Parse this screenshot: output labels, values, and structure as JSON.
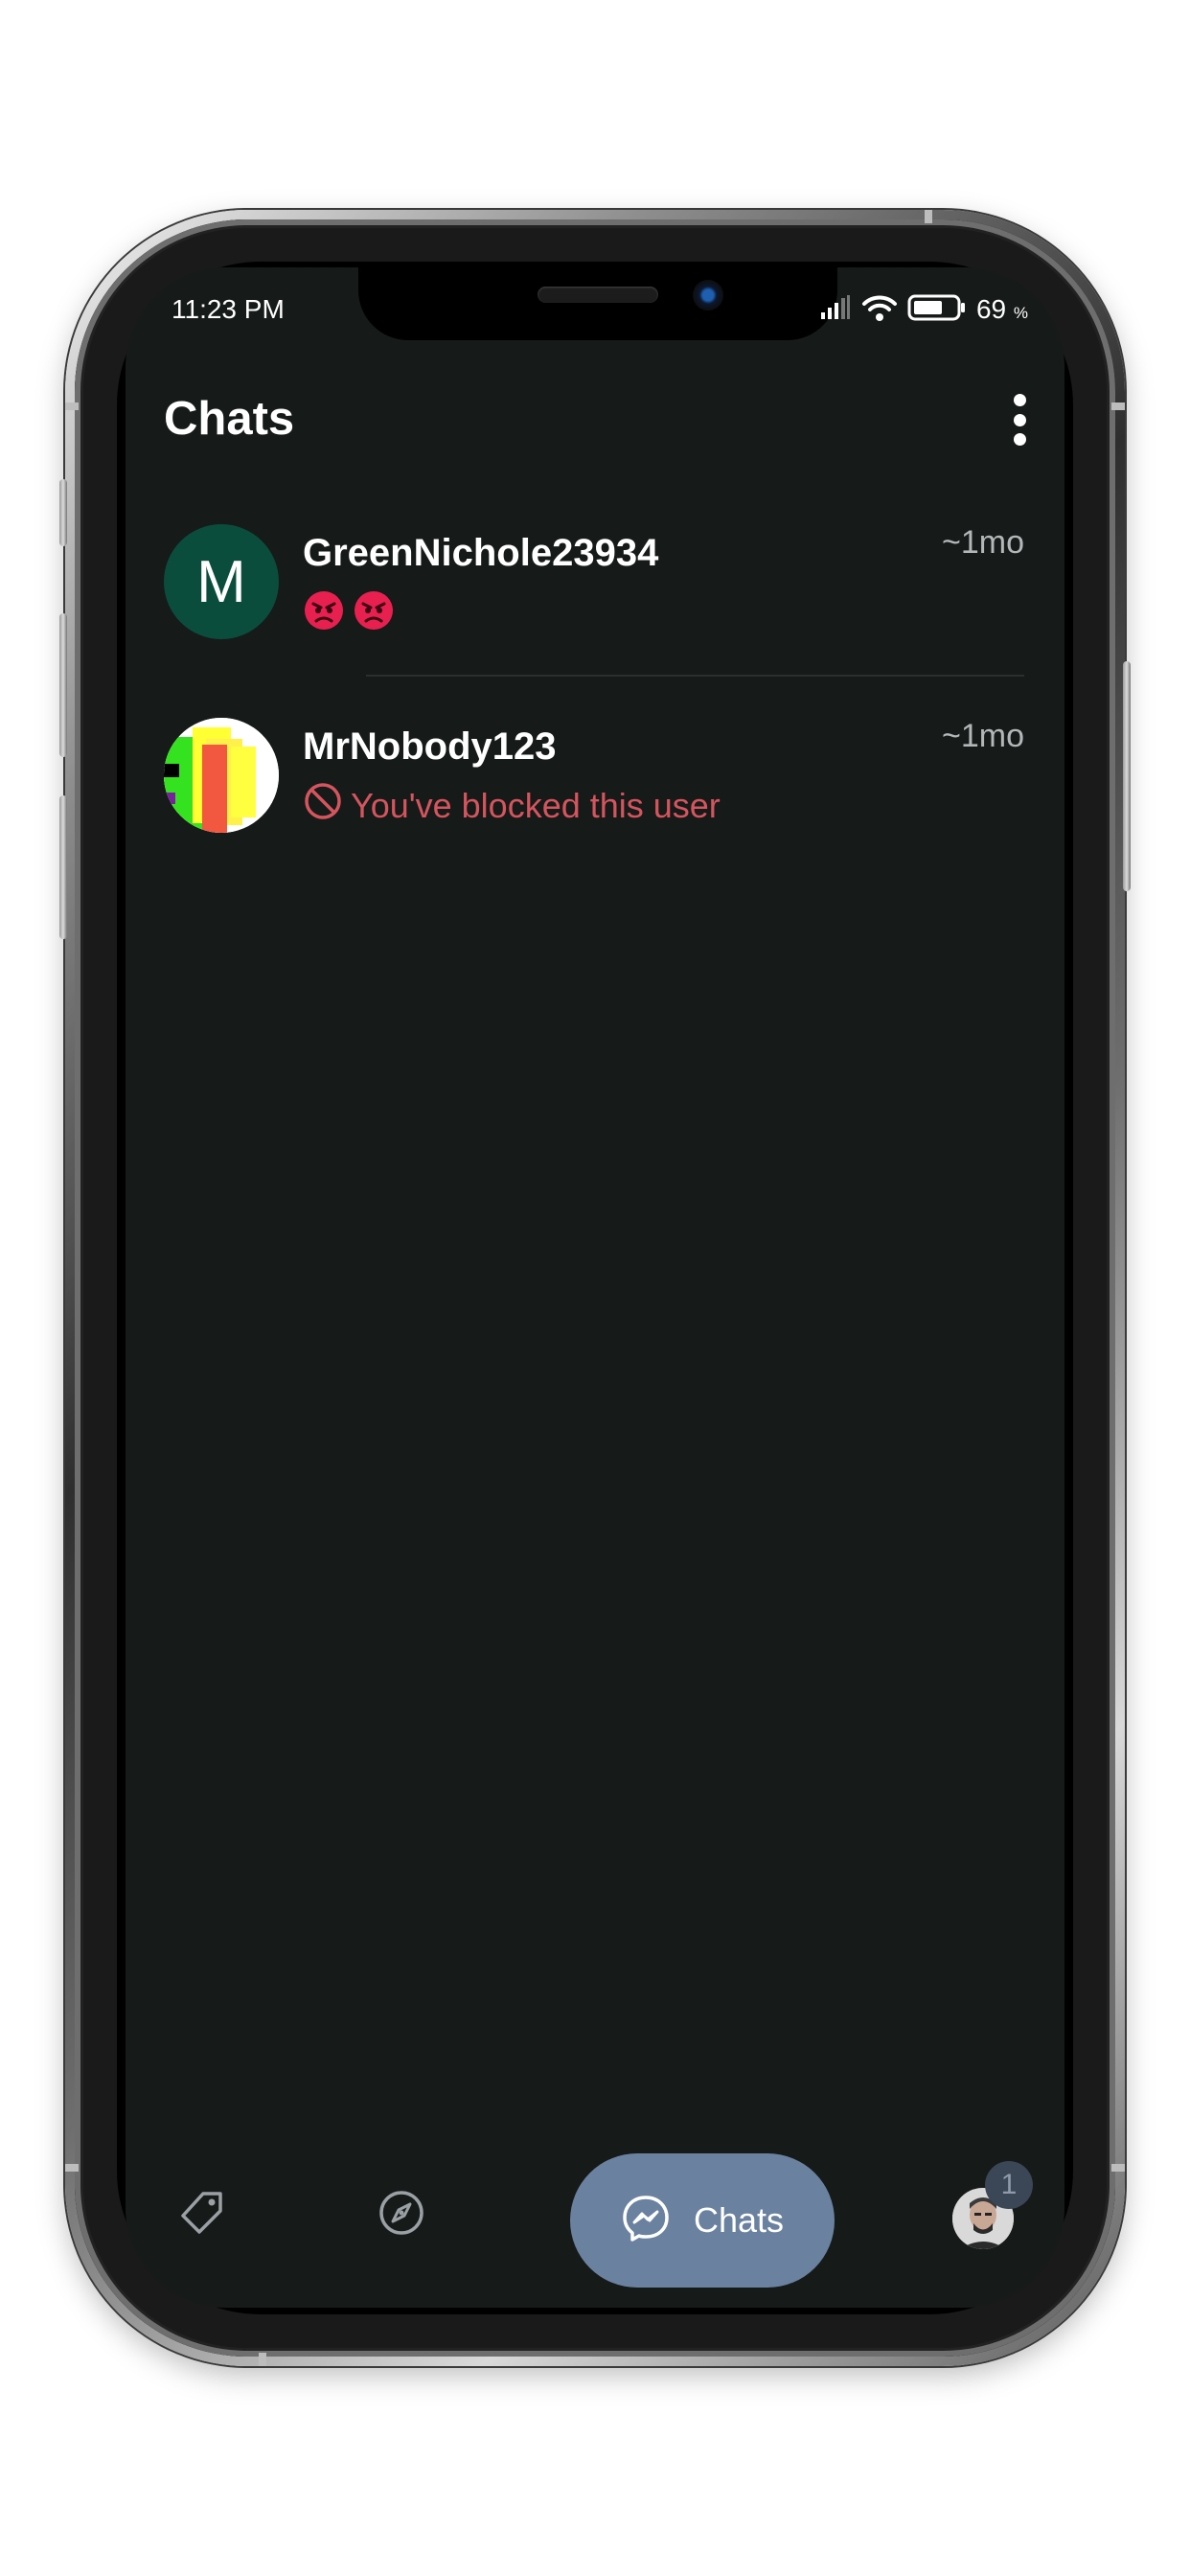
{
  "status_bar": {
    "time": "11:23 PM",
    "battery_percent": "69",
    "battery_unit": "%",
    "signal_icon": "signal-bars-icon",
    "wifi_icon": "wifi-icon",
    "battery_icon": "battery-icon",
    "battery_level": 0.69
  },
  "header": {
    "title": "Chats",
    "menu_icon": "more-vertical-icon"
  },
  "chats": [
    {
      "name": "GreenNichole23934",
      "avatar_letter": "M",
      "avatar_color": "#0b4d3c",
      "time": "~1mo",
      "preview_icons": [
        "angry-face-emoji",
        "angry-face-emoji"
      ]
    },
    {
      "name": "MrNobody123",
      "time": "~1mo",
      "preview_icon": "block-icon",
      "preview_text": "You've blocked this user",
      "preview_color": "#d5555e"
    }
  ],
  "bottom_nav": {
    "items": [
      {
        "icon": "tag-icon"
      },
      {
        "icon": "compass-icon"
      },
      {
        "icon": "messenger-icon",
        "label": "Chats",
        "active": true
      },
      {
        "icon": "profile-avatar",
        "badge": "1"
      }
    ],
    "active_color": "#6a819f"
  },
  "colors": {
    "background": "#161a19",
    "text_primary": "#ffffff",
    "text_secondary": "#b4b7b8"
  }
}
